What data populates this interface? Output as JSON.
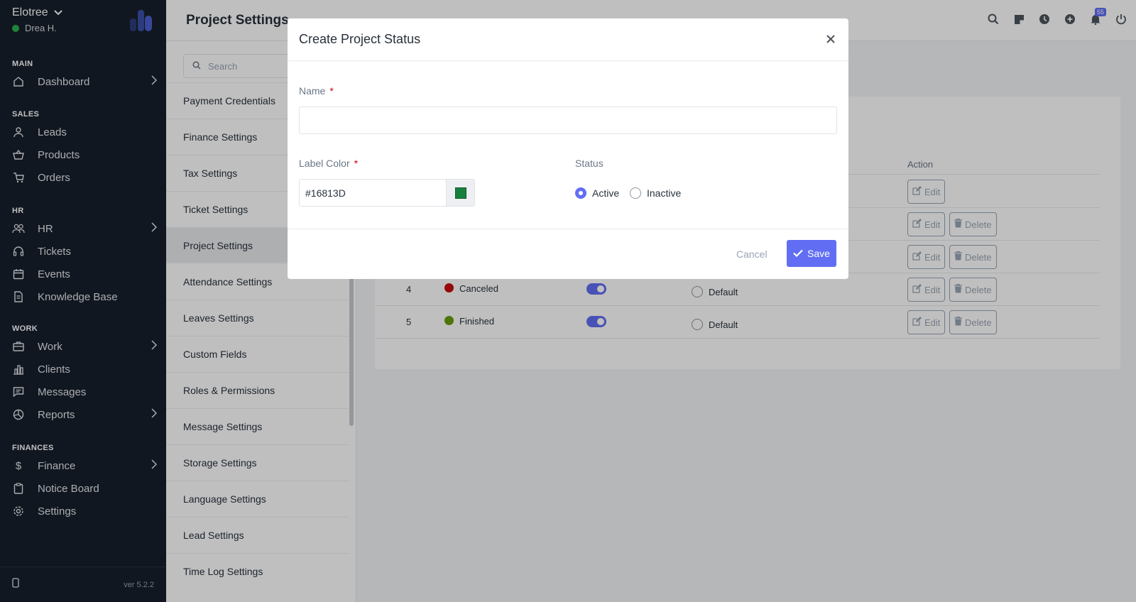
{
  "app": {
    "brand": "Elotree",
    "user": "Drea H.",
    "version": "ver 5.2.2"
  },
  "sidebar": {
    "sections": [
      "MAIN",
      "SALES",
      "HR",
      "WORK",
      "FINANCES"
    ],
    "items": [
      {
        "label": "Dashboard",
        "icon": "home-icon",
        "has_sub": true
      },
      {
        "label": "Leads",
        "icon": "user-icon",
        "has_sub": false
      },
      {
        "label": "Products",
        "icon": "basket-icon",
        "has_sub": false
      },
      {
        "label": "Orders",
        "icon": "cart-icon",
        "has_sub": false
      },
      {
        "label": "HR",
        "icon": "people-icon",
        "has_sub": true
      },
      {
        "label": "Tickets",
        "icon": "headset-icon",
        "has_sub": false
      },
      {
        "label": "Events",
        "icon": "calendar-icon",
        "has_sub": false
      },
      {
        "label": "Knowledge Base",
        "icon": "document-icon",
        "has_sub": false
      },
      {
        "label": "Work",
        "icon": "briefcase-icon",
        "has_sub": true
      },
      {
        "label": "Clients",
        "icon": "building-icon",
        "has_sub": false
      },
      {
        "label": "Messages",
        "icon": "message-icon",
        "has_sub": false
      },
      {
        "label": "Reports",
        "icon": "pie-chart-icon",
        "has_sub": true
      },
      {
        "label": "Finance",
        "icon": "dollar-icon",
        "has_sub": true
      },
      {
        "label": "Notice Board",
        "icon": "clipboard-icon",
        "has_sub": false
      },
      {
        "label": "Settings",
        "icon": "gear-icon",
        "has_sub": false
      }
    ]
  },
  "header": {
    "title": "Project Settings",
    "notification_count": "55"
  },
  "settings_menu": {
    "search_placeholder": "Search",
    "items": [
      "Payment Credentials",
      "Finance Settings",
      "Tax Settings",
      "Ticket Settings",
      "Project Settings",
      "Attendance Settings",
      "Leaves Settings",
      "Custom Fields",
      "Roles & Permissions",
      "Message Settings",
      "Storage Settings",
      "Language Settings",
      "Lead Settings",
      "Time Log Settings"
    ],
    "active_item": "Project Settings"
  },
  "status_table": {
    "action_header": "Action",
    "rows": [
      {
        "num": "",
        "name": "",
        "color": "",
        "buttons": [
          "Edit"
        ]
      },
      {
        "num": "",
        "name": "",
        "color": "",
        "buttons": [
          "Edit",
          "Delete"
        ]
      },
      {
        "num": "",
        "name": "",
        "color": "",
        "buttons": [
          "Edit",
          "Delete"
        ]
      },
      {
        "num": "4",
        "name": "Canceled",
        "color": "#c80b0b",
        "default_label": "Default",
        "buttons": [
          "Edit",
          "Delete"
        ]
      },
      {
        "num": "5",
        "name": "Finished",
        "color": "#679c0d",
        "default_label": "Default",
        "buttons": [
          "Edit",
          "Delete"
        ]
      }
    ]
  },
  "modal": {
    "title": "Create Project Status",
    "name_label": "Name",
    "name_value": "",
    "required_mark": "*",
    "label_color_label": "Label Color",
    "label_color_value": "#16813D",
    "status_label": "Status",
    "status_options": [
      "Active",
      "Inactive"
    ],
    "status_selected": "Active",
    "cancel_label": "Cancel",
    "save_label": "Save"
  },
  "colors": {
    "accent": "#616ef3",
    "sidebar_bg": "#171f2b",
    "swatch": "#16813D"
  }
}
